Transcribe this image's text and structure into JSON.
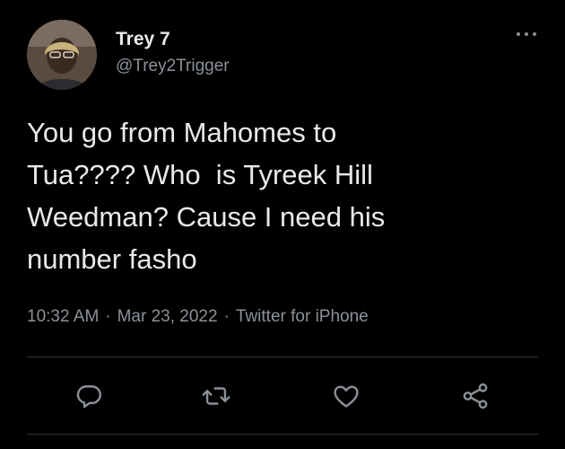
{
  "tweet": {
    "author": {
      "display_name": "Trey 7",
      "handle": "@Trey2Trigger"
    },
    "text": "You go from Mahomes to\nTua???? Who  is Tyreek Hill\nWeedman? Cause I need his\nnumber fasho",
    "time": "10:32 AM",
    "separator": "·",
    "date": "Mar 23, 2022",
    "source": "Twitter for iPhone"
  },
  "actions": {
    "icons": [
      "reply-icon",
      "retweet-icon",
      "like-icon",
      "share-icon"
    ]
  },
  "colors": {
    "background": "#000000",
    "text": "#e7e9ea",
    "secondary_text": "#8b9198",
    "divider": "#2f3336"
  }
}
